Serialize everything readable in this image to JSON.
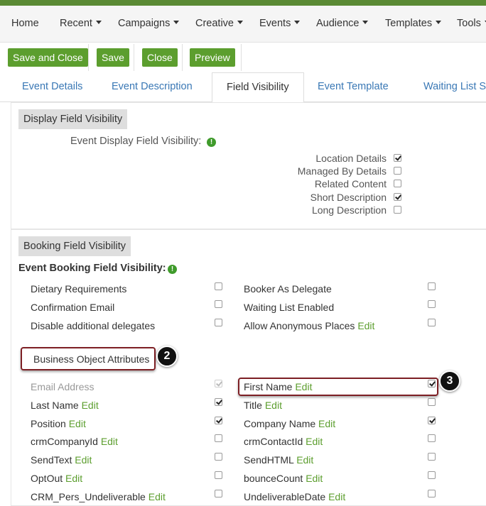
{
  "nav": {
    "home": "Home",
    "recent": "Recent",
    "campaigns": "Campaigns",
    "creative": "Creative",
    "events": "Events",
    "audience": "Audience",
    "templates": "Templates",
    "tools": "Tools"
  },
  "toolbar": {
    "save_close": "Save and Close",
    "save": "Save",
    "close": "Close",
    "preview": "Preview"
  },
  "tabs": [
    "Event Details",
    "Event Description",
    "Field Visibility",
    "Event Template",
    "Waiting List Se"
  ],
  "display_section": {
    "header": "Display Field Visibility",
    "label": "Event Display Field Visibility:",
    "fields": [
      {
        "label": "Location Details",
        "checked": true
      },
      {
        "label": "Managed By Details",
        "checked": false
      },
      {
        "label": "Related Content",
        "checked": false
      },
      {
        "label": "Short Description",
        "checked": true
      },
      {
        "label": "Long Description",
        "checked": false
      }
    ]
  },
  "booking_section": {
    "header": "Booking Field Visibility",
    "label": "Event Booking Field Visibility:",
    "left_fields": [
      {
        "label": "Dietary Requirements",
        "checked": false
      },
      {
        "label": "Confirmation Email",
        "checked": false
      },
      {
        "label": "Disable additional delegates",
        "checked": false
      }
    ],
    "right_fields": [
      {
        "label": "Booker As Delegate",
        "checked": false
      },
      {
        "label": "Waiting List Enabled",
        "checked": false
      },
      {
        "label": "Allow Anonymous Places",
        "edit": "Edit",
        "checked": false
      }
    ]
  },
  "bo_section": {
    "header": "Business Object Attributes",
    "edit_label": "Edit",
    "left": [
      {
        "label": "Email Address",
        "checked": true,
        "disabled": true
      },
      {
        "label": "Last Name",
        "checked": true
      },
      {
        "label": "Position",
        "checked": true
      },
      {
        "label": "crmCompanyId",
        "checked": false
      },
      {
        "label": "SendText",
        "checked": false
      },
      {
        "label": "OptOut",
        "checked": false
      },
      {
        "label": "CRM_Pers_Undeliverable",
        "checked": false
      }
    ],
    "right": [
      {
        "label": "First Name",
        "checked": true
      },
      {
        "label": "Title",
        "checked": false
      },
      {
        "label": "Company Name",
        "checked": true
      },
      {
        "label": "crmContactId",
        "checked": false
      },
      {
        "label": "SendHTML",
        "checked": false
      },
      {
        "label": "bounceCount",
        "checked": false
      },
      {
        "label": "UndeliverableDate",
        "checked": false
      }
    ]
  },
  "callouts": {
    "step2": "2",
    "step3": "3"
  },
  "colors": {
    "accent": "#5c9e2e",
    "link": "#3a78b5",
    "callout_border": "#7d1f24",
    "top_bar": "#5a8a34"
  }
}
